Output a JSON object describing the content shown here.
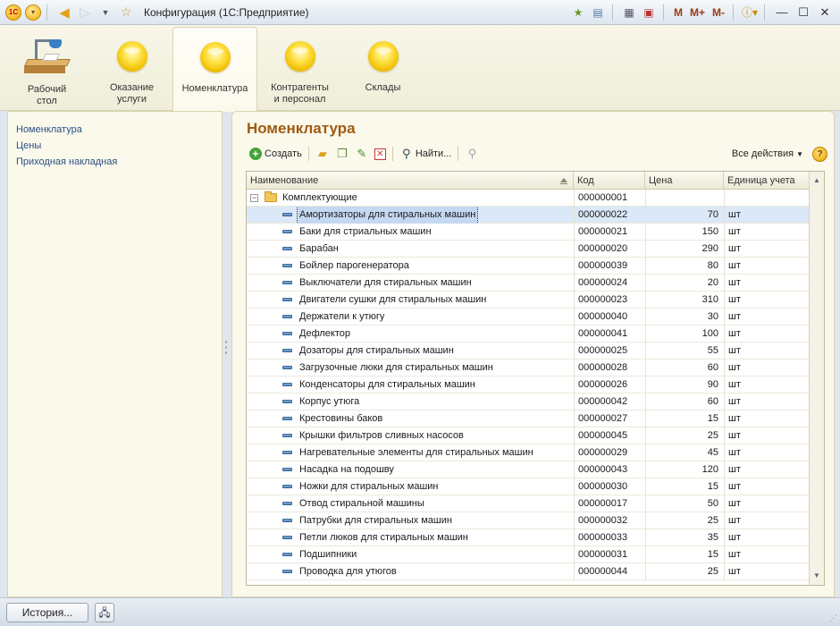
{
  "titlebar": {
    "logo": "1С",
    "title": "Конфигурация  (1С:Предприятие)",
    "memory_buttons": [
      "M",
      "M+",
      "M-"
    ],
    "icons": [
      "1c-logo-icon",
      "main-menu-icon",
      "back-arrow-icon",
      "forward-arrow-icon",
      "history-dropdown-icon",
      "favorite-star-icon",
      "add-favorite-icon",
      "bookmark-icon",
      "calculator-icon",
      "calendar-icon",
      "info-icon",
      "minimize-icon",
      "maximize-icon",
      "close-icon"
    ]
  },
  "sections": [
    {
      "label": "Рабочий стол",
      "line1": "Рабочий",
      "line2": "стол",
      "icon": "desktop-icon"
    },
    {
      "label": "Оказание услуги",
      "line1": "Оказание",
      "line2": "услуги",
      "icon": "section-bullet-icon"
    },
    {
      "label": "Номенклатура",
      "line1": "Номенклатура",
      "line2": "",
      "icon": "section-bullet-icon",
      "active": true
    },
    {
      "label": "Контрагенты и персонал",
      "line1": "Контрагенты",
      "line2": "и персонал",
      "icon": "section-bullet-icon"
    },
    {
      "label": "Склады",
      "line1": "Склады",
      "line2": "",
      "icon": "section-bullet-icon"
    }
  ],
  "nav": {
    "links": [
      "Номенклатура",
      "Цены",
      "Приходная накладная"
    ]
  },
  "main": {
    "title": "Номенклатура",
    "toolbar": {
      "create": "Создать",
      "find": "Найти...",
      "all_actions": "Все действия",
      "help": "?"
    },
    "table": {
      "columns": [
        "Наименование",
        "Код",
        "Цена",
        "Единица учета"
      ],
      "group_row": {
        "name": "Комплектующие",
        "code": "000000001",
        "price": "",
        "unit": ""
      },
      "rows": [
        {
          "name": "Амортизаторы для стиральных машин",
          "code": "000000022",
          "price": "70",
          "unit": "шт",
          "selected": true
        },
        {
          "name": "Баки для стриальных машин",
          "code": "000000021",
          "price": "150",
          "unit": "шт"
        },
        {
          "name": "Барабан",
          "code": "000000020",
          "price": "290",
          "unit": "шт"
        },
        {
          "name": "Бойлер парогенератора",
          "code": "000000039",
          "price": "80",
          "unit": "шт"
        },
        {
          "name": "Выключатели для стиральных машин",
          "code": "000000024",
          "price": "20",
          "unit": "шт"
        },
        {
          "name": "Двигатели сушки для стиральных машин",
          "code": "000000023",
          "price": "310",
          "unit": "шт"
        },
        {
          "name": "Держатели к утюгу",
          "code": "000000040",
          "price": "30",
          "unit": "шт"
        },
        {
          "name": "Дефлектор",
          "code": "000000041",
          "price": "100",
          "unit": "шт"
        },
        {
          "name": "Дозаторы для стиральных машин",
          "code": "000000025",
          "price": "55",
          "unit": "шт"
        },
        {
          "name": "Загрузочные люки для стиральных машин",
          "code": "000000028",
          "price": "60",
          "unit": "шт"
        },
        {
          "name": "Конденсаторы для стиральных машин",
          "code": "000000026",
          "price": "90",
          "unit": "шт"
        },
        {
          "name": "Корпус утюга",
          "code": "000000042",
          "price": "60",
          "unit": "шт"
        },
        {
          "name": "Крестовины баков",
          "code": "000000027",
          "price": "15",
          "unit": "шт"
        },
        {
          "name": "Крышки фильтров сливных насосов",
          "code": "000000045",
          "price": "25",
          "unit": "шт"
        },
        {
          "name": "Нагревательные элементы для стиральных машин",
          "code": "000000029",
          "price": "45",
          "unit": "шт"
        },
        {
          "name": "Насадка на подошву",
          "code": "000000043",
          "price": "120",
          "unit": "шт"
        },
        {
          "name": "Ножки для стиральных машин",
          "code": "000000030",
          "price": "15",
          "unit": "шт"
        },
        {
          "name": "Отвод стиральной машины",
          "code": "000000017",
          "price": "50",
          "unit": "шт"
        },
        {
          "name": "Патрубки для стиральных машин",
          "code": "000000032",
          "price": "25",
          "unit": "шт"
        },
        {
          "name": "Петли люков для стиральных машин",
          "code": "000000033",
          "price": "35",
          "unit": "шт"
        },
        {
          "name": "Подшипники",
          "code": "000000031",
          "price": "15",
          "unit": "шт"
        },
        {
          "name": "Проводка для утюгов",
          "code": "000000044",
          "price": "25",
          "unit": "шт"
        }
      ]
    }
  },
  "statusbar": {
    "history": "История..."
  },
  "colors": {
    "accent_title": "#a05a10",
    "selection": "#dbe8f7",
    "panel_bg": "#fbf9ec",
    "link": "#2b4f82"
  }
}
